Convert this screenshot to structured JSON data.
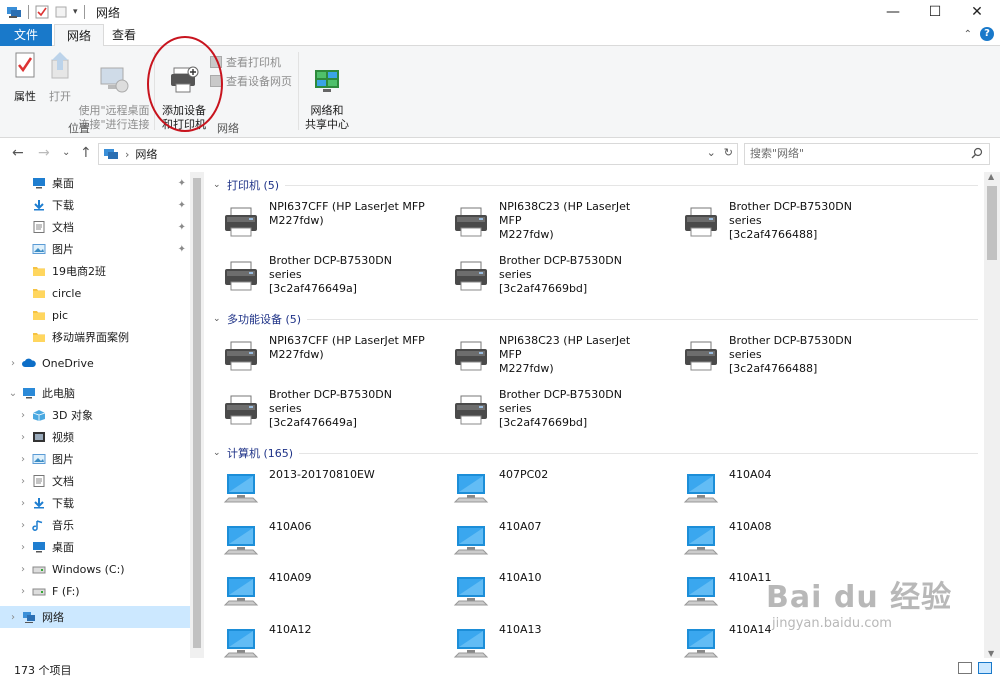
{
  "window": {
    "title": "网络",
    "minimize": "—",
    "maximize": "☐",
    "close": "✕"
  },
  "ribbon": {
    "tabs": [
      "文件",
      "网络",
      "查看"
    ],
    "help": "?",
    "buttons": {
      "properties": "属性",
      "open": "打开",
      "remote_desktop": "使用\"远程桌面\n连接\"进行连接",
      "add_device": "添加设备\n和打印机",
      "view_printers": "查看打印机",
      "view_device_webpage": "查看设备网页",
      "network_center": "网络和\n共享中心"
    },
    "groups": {
      "location": "位置",
      "network": "网络"
    }
  },
  "address": {
    "path": "网络",
    "search_placeholder": "搜索\"网络\""
  },
  "nav": {
    "items": [
      {
        "label": "桌面",
        "icon": "desktop-icon",
        "pinned": true,
        "level": 1
      },
      {
        "label": "下载",
        "icon": "download-icon",
        "pinned": true,
        "level": 1
      },
      {
        "label": "文档",
        "icon": "document-icon",
        "pinned": true,
        "level": 1
      },
      {
        "label": "图片",
        "icon": "picture-icon",
        "pinned": true,
        "level": 1
      },
      {
        "label": "19电商2班",
        "icon": "folder-icon",
        "pinned": false,
        "level": 1
      },
      {
        "label": "circle",
        "icon": "folder-icon",
        "pinned": false,
        "level": 1
      },
      {
        "label": "pic",
        "icon": "folder-icon",
        "pinned": false,
        "level": 1
      },
      {
        "label": "移动端界面案例",
        "icon": "folder-icon",
        "pinned": false,
        "level": 1
      },
      {
        "label": "OneDrive",
        "icon": "cloud-icon",
        "pinned": false,
        "level": 0,
        "chevron": "›"
      },
      {
        "label": "此电脑",
        "icon": "pc-icon",
        "pinned": false,
        "level": 0,
        "chevron": "⌄"
      },
      {
        "label": "3D 对象",
        "icon": "3d-icon",
        "pinned": false,
        "level": 1,
        "chevron": "›"
      },
      {
        "label": "视频",
        "icon": "video-icon",
        "pinned": false,
        "level": 1,
        "chevron": "›"
      },
      {
        "label": "图片",
        "icon": "picture-icon",
        "pinned": false,
        "level": 1,
        "chevron": "›"
      },
      {
        "label": "文档",
        "icon": "document-icon",
        "pinned": false,
        "level": 1,
        "chevron": "›"
      },
      {
        "label": "下载",
        "icon": "download-icon",
        "pinned": false,
        "level": 1,
        "chevron": "›"
      },
      {
        "label": "音乐",
        "icon": "music-icon",
        "pinned": false,
        "level": 1,
        "chevron": "›"
      },
      {
        "label": "桌面",
        "icon": "desktop-icon",
        "pinned": false,
        "level": 1,
        "chevron": "›"
      },
      {
        "label": "Windows (C:)",
        "icon": "drive-icon",
        "pinned": false,
        "level": 1,
        "chevron": "›"
      },
      {
        "label": "F (F:)",
        "icon": "drive-icon",
        "pinned": false,
        "level": 1,
        "chevron": "›"
      },
      {
        "label": "网络",
        "icon": "network-icon",
        "pinned": false,
        "level": 0,
        "chevron": "›",
        "selected": true
      }
    ]
  },
  "content": {
    "groups": [
      {
        "header": "打印机 (5)",
        "type": "printer",
        "items": [
          "NPI637CFF (HP LaserJet MFP\nM227fdw)",
          "NPI638C23 (HP LaserJet MFP\nM227fdw)",
          "Brother DCP-B7530DN series\n[3c2af4766488]",
          "Brother DCP-B7530DN series\n[3c2af476649a]",
          "Brother DCP-B7530DN series\n[3c2af47669bd]"
        ]
      },
      {
        "header": "多功能设备 (5)",
        "type": "printer",
        "items": [
          "NPI637CFF (HP LaserJet MFP\nM227fdw)",
          "NPI638C23 (HP LaserJet MFP\nM227fdw)",
          "Brother DCP-B7530DN series\n[3c2af4766488]",
          "Brother DCP-B7530DN series\n[3c2af476649a]",
          "Brother DCP-B7530DN series\n[3c2af47669bd]"
        ]
      },
      {
        "header": "计算机 (165)",
        "type": "computer",
        "items": [
          "2013-20170810EW",
          "407PC02",
          "410A04",
          "410A06",
          "410A07",
          "410A08",
          "410A09",
          "410A10",
          "410A11",
          "410A12",
          "410A13",
          "410A14"
        ]
      }
    ]
  },
  "status": {
    "count": "173 个项目"
  },
  "watermark": {
    "line1": "Bai du 经验",
    "line2": "jingyan.baidu.com"
  },
  "colors": {
    "accent": "#1979ca",
    "selected_bg": "#cce8ff",
    "annotation": "#c8141e",
    "group_header": "#1e3287"
  }
}
